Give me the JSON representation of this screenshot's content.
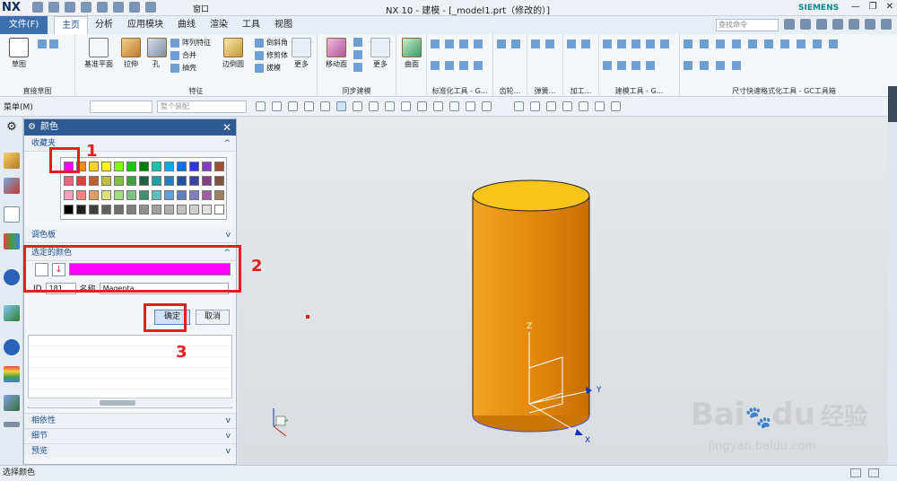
{
  "app": {
    "logo": "NX",
    "window_title": "NX 10 - 建模 - [_model1.prt（修改的）]",
    "brand": "SIEMENS",
    "window_menu_label": "窗口"
  },
  "menubar": {
    "file_label": "文件(F)",
    "tabs": [
      {
        "label": "主页",
        "active": true
      },
      {
        "label": "分析"
      },
      {
        "label": "应用模块"
      },
      {
        "label": "曲线"
      },
      {
        "label": "渲染"
      },
      {
        "label": "工具"
      },
      {
        "label": "视图"
      }
    ],
    "command_search_placeholder": "查找命令"
  },
  "ribbon": {
    "groups": [
      {
        "label": "直接草图",
        "buttons": [
          "草图"
        ]
      },
      {
        "label": "特征",
        "buttons": [
          "基准平面",
          "拉伸",
          "孔",
          "边倒圆"
        ],
        "small": [
          "阵列特征",
          "合并",
          "抽壳",
          "倒斜角",
          "修剪体",
          "拔模",
          "更多"
        ]
      },
      {
        "label": "同步建模",
        "buttons": [
          "移动面",
          "更多"
        ]
      },
      {
        "label": "",
        "buttons": [
          "曲面"
        ]
      },
      {
        "label": "标准化工具 - G...",
        "buttons": []
      },
      {
        "label": "齿轮...",
        "buttons": []
      },
      {
        "label": "弹簧...",
        "buttons": []
      },
      {
        "label": "加工...",
        "buttons": []
      },
      {
        "label": "建模工具 - G...",
        "buttons": []
      },
      {
        "label": "尺寸快速格式化工具 - GC工具箱",
        "buttons": []
      }
    ]
  },
  "toolbar2": {
    "menu_label": "菜单(M)",
    "filter_placeholder": "",
    "assembly_placeholder": "整个装配"
  },
  "dialog": {
    "title": "颜色",
    "favorites_label": "收藏夹",
    "palette_label": "调色板",
    "selected_color_label": "选定的颜色",
    "selected_color_hex": "#ff00ff",
    "id_label": "ID",
    "id_value": "181",
    "name_label": "名称",
    "name_value": "Magenta",
    "ok_label": "确定",
    "cancel_label": "取消",
    "dependencies_label": "相依性",
    "details_label": "细节",
    "preview_label": "预览"
  },
  "palette_colors": [
    "#ff00ff",
    "#ff8c00",
    "#ffd700",
    "#ffff00",
    "#80ff00",
    "#00cc00",
    "#008000",
    "#00ccaa",
    "#00aaff",
    "#0070ff",
    "#3030ff",
    "#8040c0",
    "#a05030",
    "#ff6080",
    "#e04040",
    "#c06030",
    "#c0c040",
    "#80c040",
    "#40a040",
    "#206040",
    "#20a0a0",
    "#2080c0",
    "#2050a0",
    "#4040a0",
    "#804080",
    "#805040",
    "#ffa0c0",
    "#ff8080",
    "#e0a060",
    "#e0e080",
    "#a0e080",
    "#80c080",
    "#409070",
    "#60c0c0",
    "#60a0e0",
    "#6080c0",
    "#8080c0",
    "#a060a0",
    "#a08060",
    "#000000",
    "#202020",
    "#404040",
    "#606060",
    "#707070",
    "#808080",
    "#909090",
    "#a0a0a0",
    "#b0b0b0",
    "#c0c0c0",
    "#d0d0d0",
    "#e0e0e0",
    "#ffffff"
  ],
  "viewport": {
    "axis_z": "Z",
    "axis_y": "Y",
    "axis_x": "X",
    "body_color": "#e8900e",
    "top_color": "#f7c41a"
  },
  "annotations": [
    "1",
    "2",
    "3"
  ],
  "status": {
    "text": "选择颜色"
  },
  "watermark": {
    "brand": "Bai",
    "brand2": "du",
    "cn": "经验",
    "url": "jingyan.baidu.com"
  }
}
